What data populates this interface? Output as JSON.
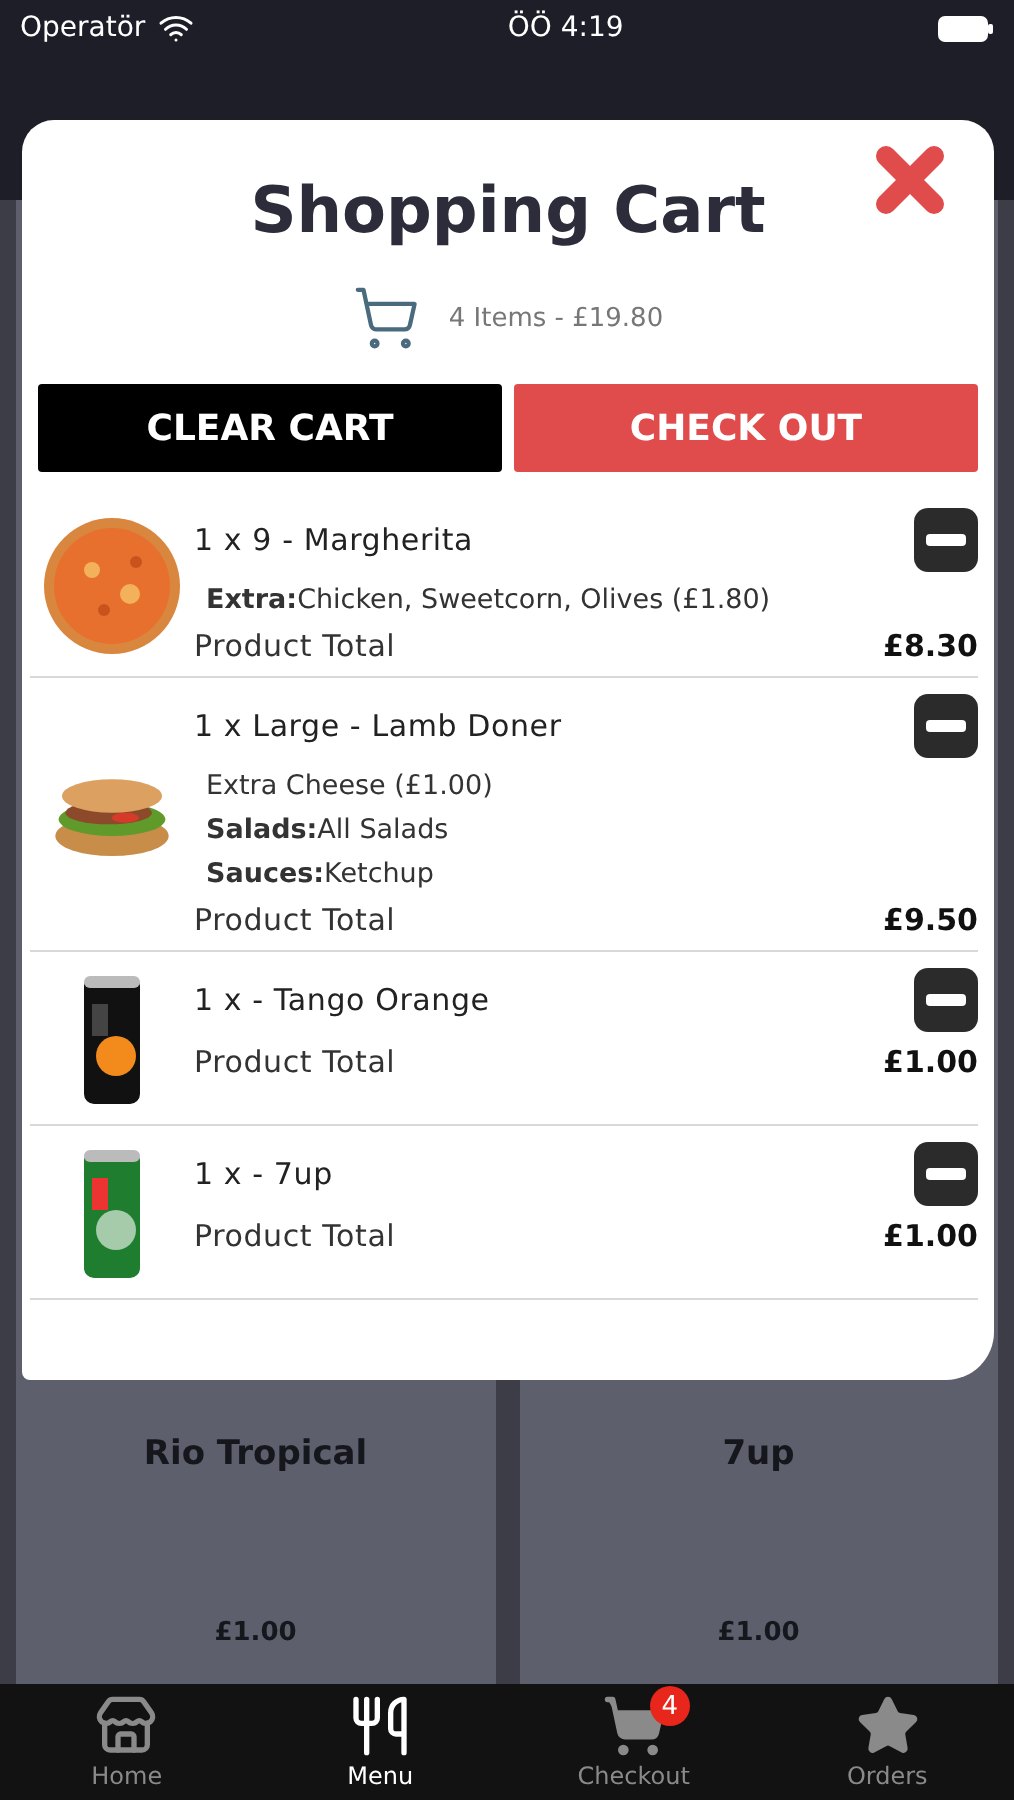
{
  "status_bar": {
    "carrier": "Operatör",
    "time": "ÖÖ 4:19"
  },
  "background_products": [
    {
      "name": "Rio Tropical",
      "price": "£1.00"
    },
    {
      "name": "7up",
      "price": "£1.00"
    }
  ],
  "cart": {
    "title": "Shopping Cart",
    "summary": "4 Items - £19.80",
    "buttons": [
      {
        "label": "CLEAR CART",
        "kind": "secondary"
      },
      {
        "label": "CHECK OUT",
        "kind": "primary"
      }
    ],
    "items": [
      {
        "name": "1 x 9 - Margherita",
        "details": [
          "**Extra:**Chicken, Sweetcorn, Olives (£1.80)"
        ],
        "total_label": "Product Total",
        "total": "£8.30"
      },
      {
        "name": "1 x Large - Lamb Doner",
        "details": [
          "Extra Cheese (£1.00)",
          "**Salads:**All Salads",
          "**Sauces:**Ketchup"
        ],
        "total_label": "Product Total",
        "total": "£9.50"
      },
      {
        "name": "1 x - Tango Orange",
        "total_label": "Product Total",
        "total": "£1.00"
      },
      {
        "name": "1 x - 7up",
        "total_label": "Product Total",
        "total": "£1.00"
      }
    ]
  },
  "tab_bar": [
    {
      "label": "Home",
      "selected": false
    },
    {
      "label": "Menu",
      "selected": true
    },
    {
      "label": "Checkout",
      "selected": false,
      "badge": "4"
    },
    {
      "label": "Orders",
      "selected": false
    }
  ]
}
